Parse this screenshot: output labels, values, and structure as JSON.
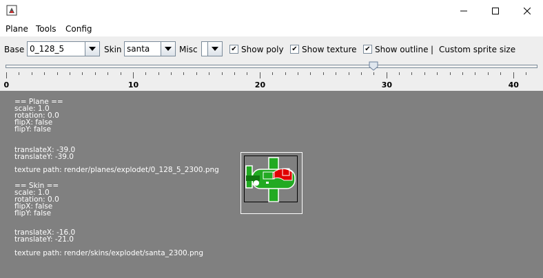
{
  "window": {
    "icon": "java-app-icon",
    "controls": [
      "minimize-icon",
      "maximize-icon",
      "close-icon"
    ]
  },
  "menu": {
    "plane": "Plane",
    "tools": "Tools",
    "config": "Config"
  },
  "toolbar": {
    "base_label": "Base",
    "base_value": "0_128_5",
    "skin_label": "Skin",
    "skin_value": "santa",
    "misc_label": "Misc",
    "misc_value": "",
    "show_poly": "Show poly",
    "show_poly_checked": true,
    "show_texture": "Show texture",
    "show_texture_checked": true,
    "show_outline": "Show outline",
    "show_outline_checked": true,
    "separator": "|",
    "custom_sprite_size": "Custom sprite size"
  },
  "slider": {
    "min": 0,
    "max": 41,
    "value": 29,
    "tick_labels": [
      "0",
      "10",
      "20",
      "30",
      "40"
    ]
  },
  "plane_info": {
    "header": "== Plane ==",
    "scale": "scale: 1.0",
    "rotation": "rotation: 0.0",
    "flipx": "flipX: false",
    "flipy": "flipY: false",
    "translatex": "translateX: -39.0",
    "translatey": "translateY: -39.0",
    "texture_path": "texture path: render/planes/explodet/0_128_5_2300.png"
  },
  "skin_info": {
    "header": "== Skin ==",
    "scale": "scale: 1.0",
    "rotation": "rotation: 0.0",
    "flipx": "flipX: false",
    "flipy": "flipY: false",
    "translatex": "translateX: -16.0",
    "translatey": "translateY: -21.0",
    "texture_path": "texture path: render/skins/explodet/santa_2300.png"
  },
  "colors": {
    "canvas_bg": "#808080",
    "toolbar_bg": "#eeeeee",
    "plane_green": "#22aa22",
    "skin_red": "#e00000"
  }
}
